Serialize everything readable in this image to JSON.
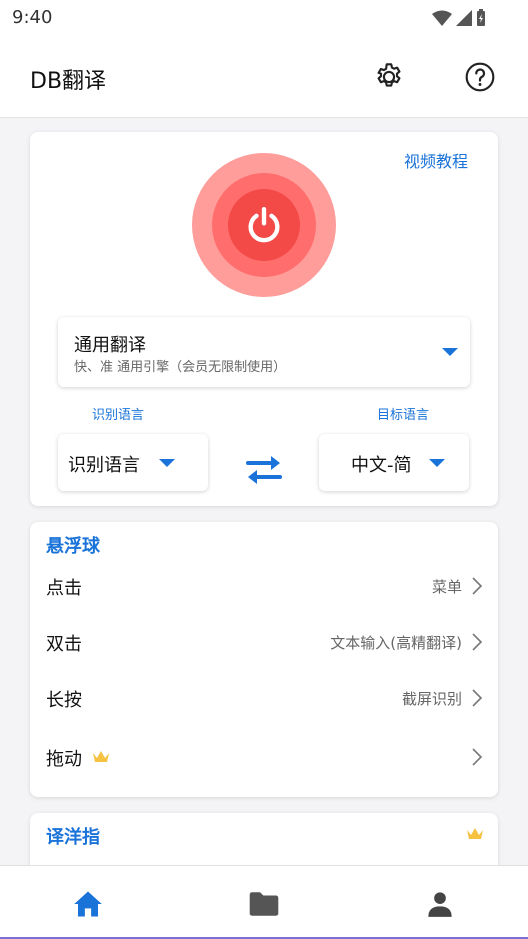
{
  "status": {
    "time": "9:40"
  },
  "app": {
    "title": "DB翻译"
  },
  "header": {
    "settings_icon": "gear-icon",
    "help_icon": "help-circle-icon"
  },
  "main": {
    "video_link": "视频教程",
    "power_icon": "power-icon",
    "power_color": "#f34a48",
    "engine": {
      "name": "通用翻译",
      "desc": "快、准 通用引擎（会员无限制使用）"
    },
    "source_label": "识别语言",
    "target_label": "目标语言",
    "source_value": "识别语言",
    "target_value": "中文-简",
    "swap_icon": "swap-arrows-icon"
  },
  "float_ball": {
    "title": "悬浮球",
    "rows": [
      {
        "label": "点击",
        "value": "菜单"
      },
      {
        "label": "双击",
        "value": "文本输入(高精翻译)"
      },
      {
        "label": "长按",
        "value": "截屏识别"
      },
      {
        "label": "拖动",
        "value": ""
      }
    ]
  },
  "yiyang": {
    "title": "译洋指"
  },
  "nav": {
    "items": [
      "home-icon",
      "folder-icon",
      "person-icon"
    ]
  },
  "colors": {
    "accent": "#1a73d9",
    "crown": "#f5c242"
  }
}
